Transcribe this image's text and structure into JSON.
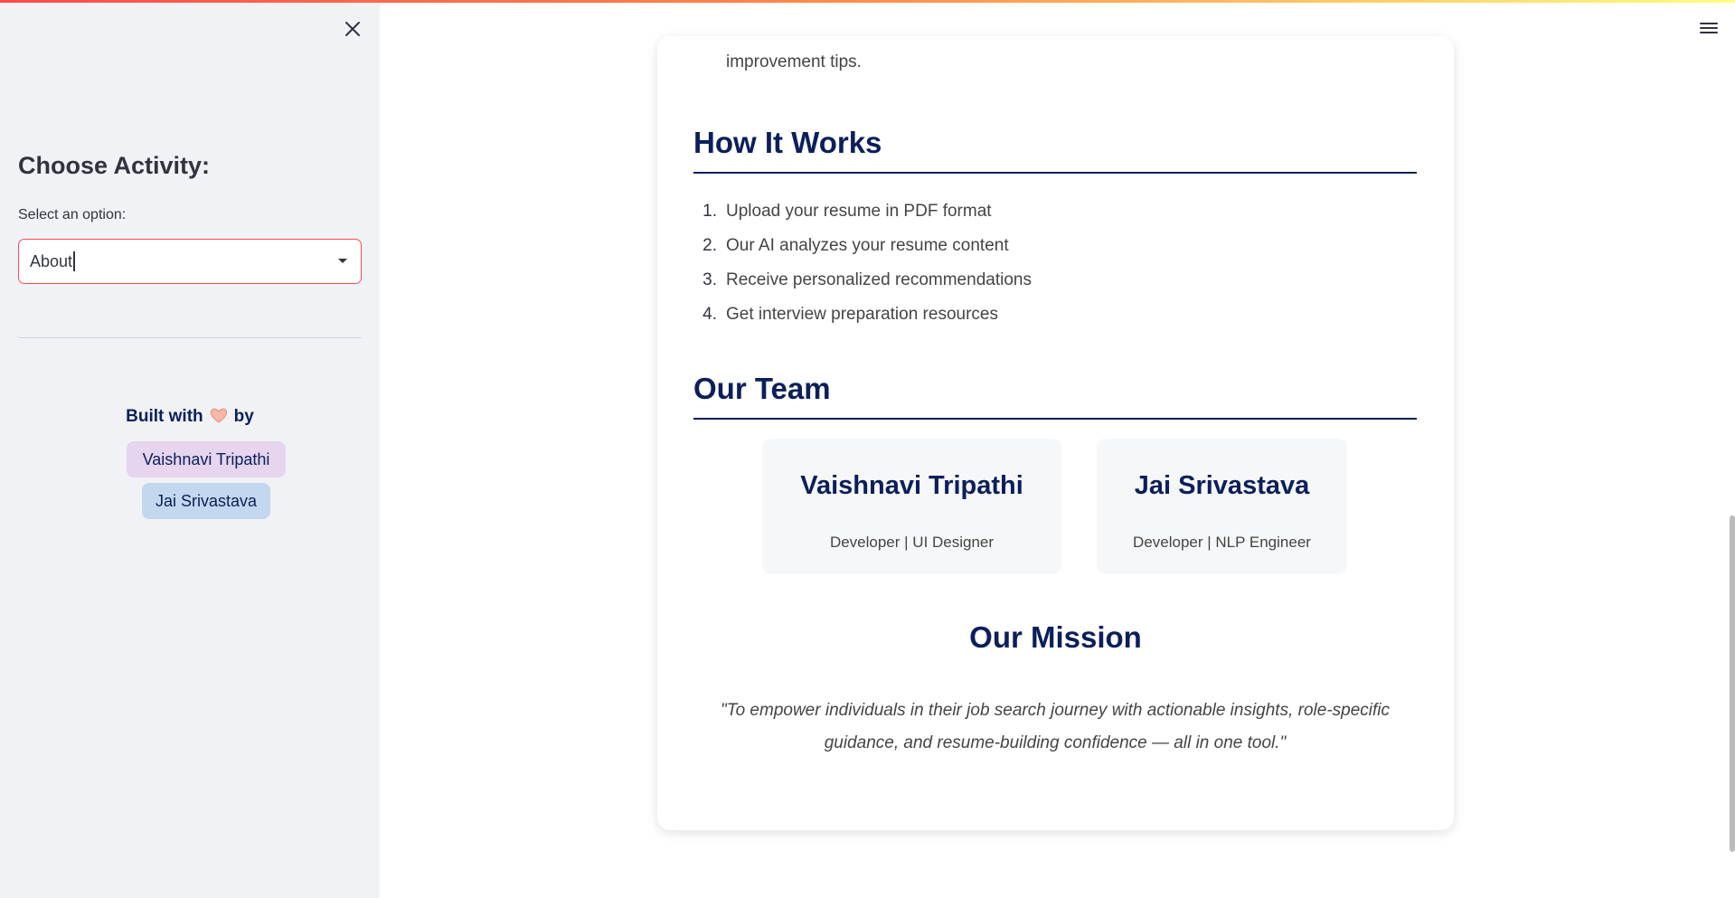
{
  "sidebar": {
    "heading": "Choose Activity:",
    "select_label": "Select an option:",
    "select_value": "About",
    "built_with_prefix": "Built with",
    "built_with_suffix": "by",
    "authors": [
      "Vaishnavi Tripathi",
      "Jai Srivastava"
    ]
  },
  "main": {
    "tip_text": "improvement tips.",
    "how_it_works": {
      "title": "How It Works",
      "steps": [
        {
          "num": "1.",
          "text": "Upload your resume in PDF format"
        },
        {
          "num": "2.",
          "text": "Our AI analyzes your resume content"
        },
        {
          "num": "3.",
          "text": "Receive personalized recommendations"
        },
        {
          "num": "4.",
          "text": "Get interview preparation resources"
        }
      ]
    },
    "team": {
      "title": "Our Team",
      "members": [
        {
          "name": "Vaishnavi Tripathi",
          "role": "Developer | UI Designer"
        },
        {
          "name": "Jai Srivastava",
          "role": "Developer | NLP Engineer"
        }
      ]
    },
    "mission": {
      "title": "Our Mission",
      "quote": "\"To empower individuals in their job search journey with actionable insights, role-specific guidance, and resume-building confidence — all in one tool.\""
    }
  },
  "colors": {
    "accent_red": "#ff4b4b",
    "heading_navy": "#0b1f5c",
    "sidebar_bg": "#f0f2f6",
    "chip_purple": "#e6d5ee",
    "chip_blue": "#c3d7ee"
  },
  "icons": {
    "close": "close-icon",
    "menu": "hamburger-menu-icon",
    "dropdown": "chevron-down-icon",
    "heart": "heart-hands-icon"
  }
}
